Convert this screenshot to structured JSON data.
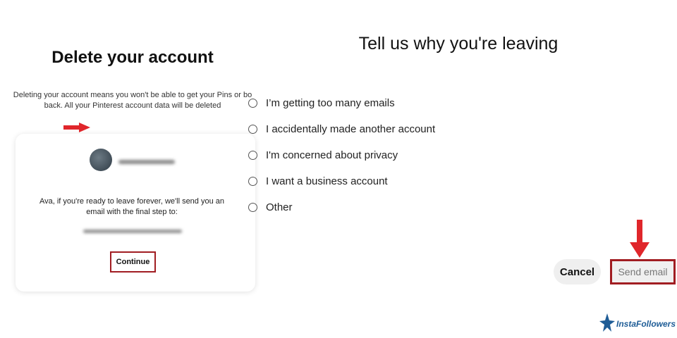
{
  "left_panel": {
    "title": "Delete your account",
    "description_line1": "Deleting your account means you won't be able to get your Pins or bo",
    "description_line2": "back. All your Pinterest account data will be deleted",
    "card": {
      "message_line1": "Ava, if you're ready to leave forever, we'll send you an",
      "message_line2": "email with the final step to:",
      "continue_label": "Continue"
    }
  },
  "right_panel": {
    "title": "Tell us why you're leaving",
    "options": [
      {
        "label": "I’m getting too many emails"
      },
      {
        "label": "I accidentally made another account"
      },
      {
        "label": "I'm concerned about privacy"
      },
      {
        "label": "I want a business account"
      },
      {
        "label": "Other"
      }
    ],
    "cancel_label": "Cancel",
    "send_label": "Send email"
  },
  "watermark": {
    "text": "InstaFollowers"
  },
  "colors": {
    "highlight_border": "#a11d22",
    "arrow": "#e0262b",
    "logo": "#1e5c96"
  }
}
